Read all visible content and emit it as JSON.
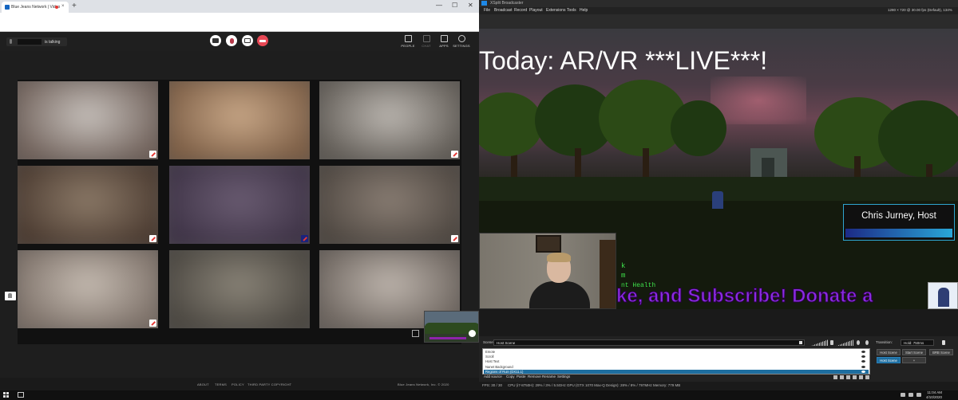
{
  "browser": {
    "tab_title": "Blue Jeans Network | Video",
    "tab_close": "×",
    "new_tab": "+",
    "win_min": "—",
    "win_max": "☐",
    "win_close": "✕"
  },
  "bluejeans": {
    "talking_label": "is talking",
    "right_tools": [
      {
        "icon": "people-icon",
        "label": "PEOPLE"
      },
      {
        "icon": "chat-icon",
        "label": "CHAT"
      },
      {
        "icon": "apps-icon",
        "label": "APPS"
      },
      {
        "icon": "settings-icon",
        "label": "SETTINGS"
      }
    ],
    "tile_colors": [
      [
        "#c8c2bd",
        "#6e5f58"
      ],
      [
        "#c9a888",
        "#7a5c44"
      ],
      [
        "#bdb8b2",
        "#5f5a54"
      ],
      [
        "#8c7a68",
        "#4a3a30"
      ],
      [
        "#6a5c72",
        "#3e3346"
      ],
      [
        "#8a7e74",
        "#4d4640"
      ],
      [
        "#c6bcb2",
        "#7a6e66"
      ],
      [
        "#8a8478",
        "#4a4640"
      ],
      [
        "#bfb6ae",
        "#6a625c"
      ]
    ],
    "footer_links": [
      "ABOUT",
      "TERMS",
      "POLICY",
      "THIRD PARTY COPYRIGHT"
    ],
    "copyright": "Blue Jeans Network, Inc. © 2020"
  },
  "xsplit": {
    "title": "XSplit Broadcaster",
    "menu": [
      "File",
      "Broadcast",
      "Record",
      "Playout",
      "Extensions",
      "Tools",
      "Help"
    ],
    "resolution": "1280 × 720 @ 30.00 fps (Default), 134%",
    "stream_title": "Today: AR/VR ***LIVE***!",
    "host_name": "Chris Jurney, Host",
    "ticker": "ke, and Subscribe!  Donate a",
    "side_text": "k\nm",
    "side_text2": "nt Health",
    "scene_label": "Scene:",
    "scene_value": "Host Scene",
    "transition_label": "Transition:",
    "transition_value": "Hold: 750ms",
    "sources": [
      "Emote",
      "Scroll",
      "Host Text",
      "Nanet Background",
      "Regions of Ruin (DX11.1)"
    ],
    "selected_source_index": 4,
    "source_buttons": [
      "Add source",
      "Copy",
      "Paste",
      "Remove",
      "Rename",
      "Settings"
    ],
    "scene_buttons": [
      "Host Scene",
      "Start Scene",
      "BRB Scene",
      "Host Scene",
      "+"
    ],
    "status": {
      "fps": "FPS:  30 / 30",
      "cpu": "CPU (i7-8750H):  29% / 3% / 5.5GHz",
      "gpu": "GPU (GTX 1070 Max-Q Design):  28% / 8% / 797MHz",
      "memory": "Memory:  779 MB"
    }
  },
  "taskbar": {
    "time": "11:04 AM",
    "date": "4/10/2020"
  }
}
